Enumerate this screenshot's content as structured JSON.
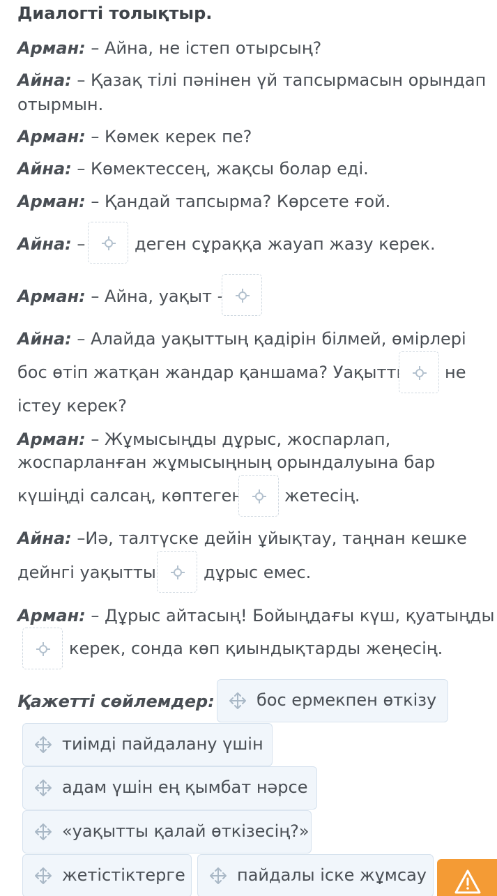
{
  "title": "Диалогті толықтыр.",
  "speakers": {
    "arman": "Арман:",
    "aina": "Айна:"
  },
  "lines": {
    "l1": "– Айна, не істеп отырсың?",
    "l2a": "– Қазақ тілі пәнінен үй тапсырмасын орындап",
    "l2b": "отырмын.",
    "l3": "– Көмек керек пе?",
    "l4": "– Көмектессең, жақсы болар еді.",
    "l5": "– Қандай тапсырма? Көрсете ғой.",
    "l6a": "–",
    "l6b": "деген сұраққа жауап жазу керек.",
    "l7a": "– Айна, уақыт –",
    "l8a": "– Алайда уақыттың қадірін білмей, өмірлері",
    "l8b": "бос өтіп жатқан жандар қаншама? Уақытты",
    "l8c": "не",
    "l8d": "істеу керек?",
    "l9a": "– Жұмысыңды дұрыс, жоспарлап,",
    "l9b": "жоспарланған жұмысыңның орындалуына бар",
    "l9c": "күшіңді салсаң, көптеген",
    "l9d": "жетесің.",
    "l10a": "–Иә, талтүске дейін ұйықтау, таңнан кешке",
    "l10b": "дейнгі уақытты",
    "l10c": "дұрыс емес.",
    "l11a": "– Дұрыс айтасың! Бойыңдағы күш, қуатыңды",
    "l11b": "керек, сонда көп қиындықтарды жеңесің."
  },
  "options_label": "Қажетті сөйлемдер:",
  "options": [
    "бос ермекпен өткізу",
    "тиімді пайдалану үшін",
    "адам үшін ең қымбат нәрсе",
    "«уақытты қалай өткізесің?»",
    "жетістіктерге",
    "пайдалы іске жұмсау"
  ],
  "icons": {
    "drop": "move-target-icon",
    "chip": "drag-move-icon",
    "warning": "warning-icon"
  },
  "colors": {
    "accent_warning": "#f49b35",
    "chip_bg": "#f1f6fb",
    "text": "#4a4f55"
  }
}
